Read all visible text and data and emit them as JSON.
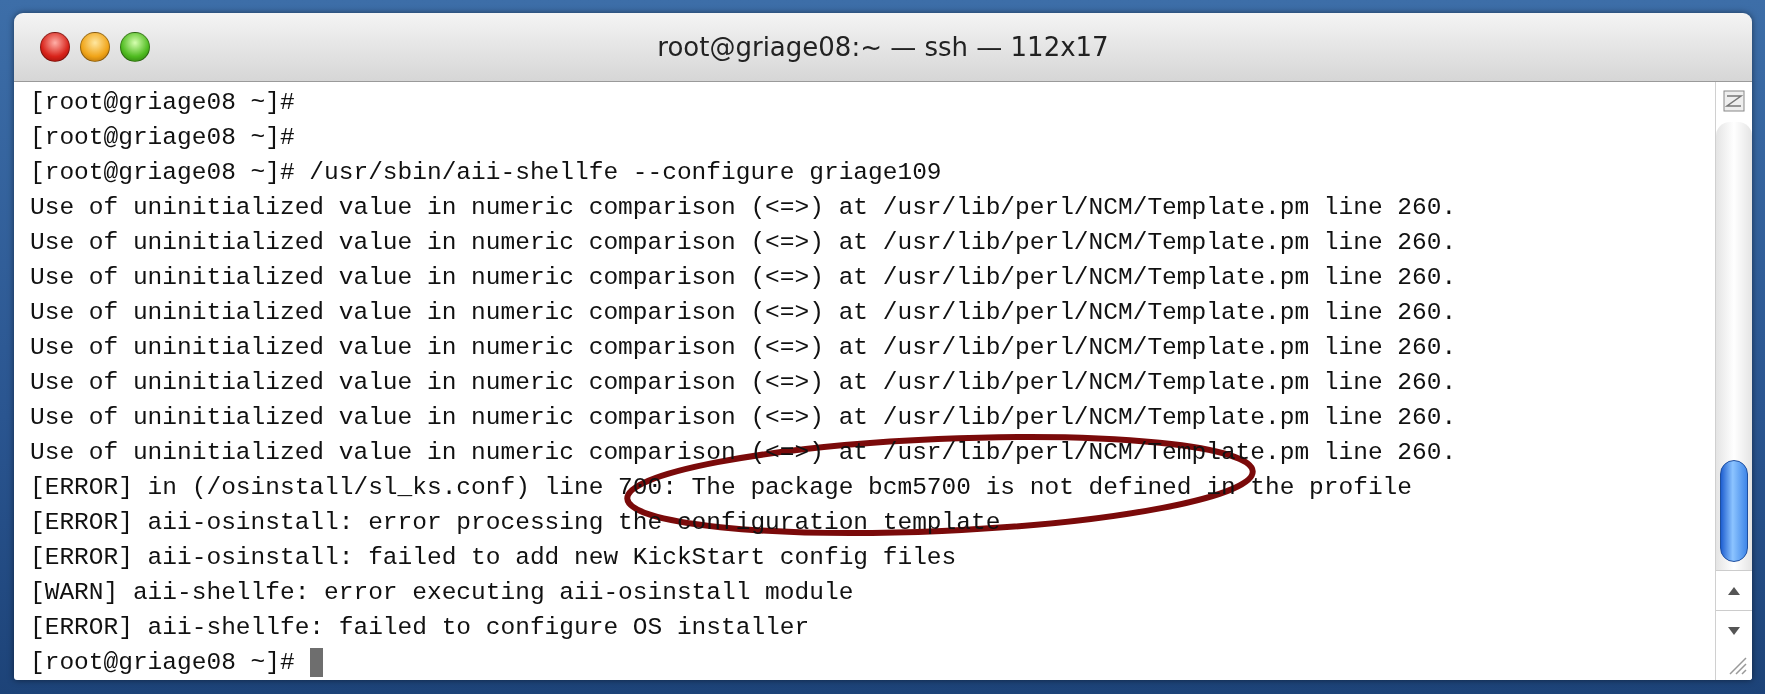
{
  "window": {
    "title": "root@griage08:~ — ssh — 112x17"
  },
  "lines": [
    {
      "text": "[root@griage08 ~]#"
    },
    {
      "text": "[root@griage08 ~]#"
    },
    {
      "text": "[root@griage08 ~]# /usr/sbin/aii-shellfe --configure griage109"
    },
    {
      "text": "Use of uninitialized value in numeric comparison (<=>) at /usr/lib/perl/NCM/Template.pm line 260."
    },
    {
      "text": "Use of uninitialized value in numeric comparison (<=>) at /usr/lib/perl/NCM/Template.pm line 260."
    },
    {
      "text": "Use of uninitialized value in numeric comparison (<=>) at /usr/lib/perl/NCM/Template.pm line 260."
    },
    {
      "text": "Use of uninitialized value in numeric comparison (<=>) at /usr/lib/perl/NCM/Template.pm line 260."
    },
    {
      "text": "Use of uninitialized value in numeric comparison (<=>) at /usr/lib/perl/NCM/Template.pm line 260."
    },
    {
      "text": "Use of uninitialized value in numeric comparison (<=>) at /usr/lib/perl/NCM/Template.pm line 260."
    },
    {
      "text": "Use of uninitialized value in numeric comparison (<=>) at /usr/lib/perl/NCM/Template.pm line 260."
    },
    {
      "text": "Use of uninitialized value in numeric comparison (<=>) at /usr/lib/perl/NCM/Template.pm line 260."
    },
    {
      "text": "[ERROR] in (/osinstall/sl_ks.conf) line 700: The package bcm5700 is not defined in the profile"
    },
    {
      "text": "[ERROR] aii-osinstall: error processing the configuration template"
    },
    {
      "text": "[ERROR] aii-osinstall: failed to add new KickStart config files"
    },
    {
      "text": "[WARN] aii-shellfe: error executing aii-osinstall module"
    },
    {
      "text": "[ERROR] aii-shellfe: failed to configure OS installer"
    },
    {
      "text": "[root@griage08 ~]#"
    }
  ]
}
